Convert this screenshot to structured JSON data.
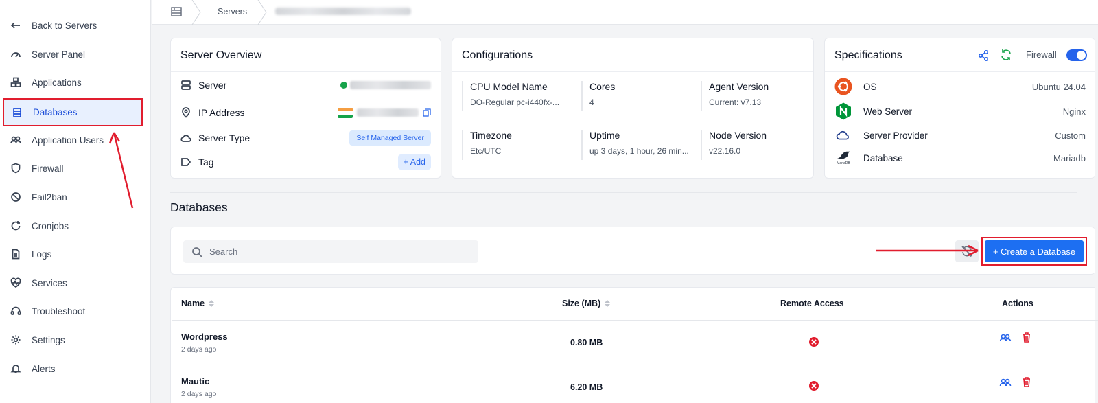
{
  "sidebar": {
    "items": [
      {
        "label": "Back to Servers",
        "icon": "arrow-left-icon"
      },
      {
        "label": "Server Panel",
        "icon": "gauge-icon"
      },
      {
        "label": "Applications",
        "icon": "cubes-icon"
      },
      {
        "label": "Databases",
        "icon": "database-icon",
        "active": true
      },
      {
        "label": "Application Users",
        "icon": "users-icon"
      },
      {
        "label": "Firewall",
        "icon": "shield-icon"
      },
      {
        "label": "Fail2ban",
        "icon": "ban-icon"
      },
      {
        "label": "Cronjobs",
        "icon": "refresh-icon"
      },
      {
        "label": "Logs",
        "icon": "file-icon"
      },
      {
        "label": "Services",
        "icon": "heartbeat-icon"
      },
      {
        "label": "Troubleshoot",
        "icon": "headset-icon"
      },
      {
        "label": "Settings",
        "icon": "gear-icon"
      },
      {
        "label": "Alerts",
        "icon": "bell-icon"
      }
    ]
  },
  "breadcrumb": {
    "servers": "Servers"
  },
  "overview": {
    "title": "Server Overview",
    "server_label": "Server",
    "ip_label": "IP Address",
    "type_label": "Server Type",
    "type_value": "Self Managed Server",
    "tag_label": "Tag",
    "add_label": "+ Add"
  },
  "config": {
    "title": "Configurations",
    "cpu_label": "CPU Model Name",
    "cpu_value": "DO-Regular pc-i440fx-...",
    "cores_label": "Cores",
    "cores_value": "4",
    "agent_label": "Agent Version",
    "agent_value": "Current: v7.13",
    "tz_label": "Timezone",
    "tz_value": "Etc/UTC",
    "uptime_label": "Uptime",
    "uptime_value": "up 3 days, 1 hour, 26 min...",
    "node_label": "Node Version",
    "node_value": "v22.16.0"
  },
  "specs": {
    "title": "Specifications",
    "firewall_label": "Firewall",
    "os_label": "OS",
    "os_value": "Ubuntu 24.04",
    "web_label": "Web Server",
    "web_value": "Nginx",
    "provider_label": "Server Provider",
    "provider_value": "Custom",
    "db_label": "Database",
    "db_value": "Mariadb",
    "mariadb_logo_text": "MariaDB"
  },
  "databases": {
    "title": "Databases",
    "search_placeholder": "Search",
    "create_label": "+ Create a Database",
    "columns": {
      "name": "Name",
      "size": "Size (MB)",
      "remote": "Remote Access",
      "actions": "Actions"
    },
    "rows": [
      {
        "name": "Wordpress",
        "created": "2 days ago",
        "size": "0.80 MB"
      },
      {
        "name": "Mautic",
        "created": "2 days ago",
        "size": "6.20 MB"
      }
    ]
  },
  "colors": {
    "accent": "#1d6ff2",
    "annotation": "#e11d2e",
    "active_bg": "#e8f0fe"
  }
}
